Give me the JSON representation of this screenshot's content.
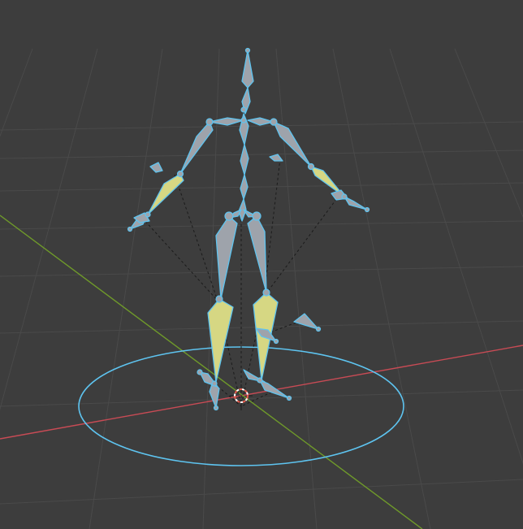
{
  "viewport": {
    "mode": "pose-mode",
    "selection": "armature-rig-all-bones-selected"
  },
  "colors": {
    "background": "#3d3d3d",
    "grid": "#4a4a4a",
    "x_axis": "#c84b55",
    "y_axis": "#6f9a2a",
    "selected_outline": "#5ec4f0",
    "bone_fill": "#9ea3ab",
    "ik_bone_fill": "#d6d783",
    "ik_line": "#1b1b1b",
    "cursor_red": "#e85a4a"
  },
  "icons": {
    "cursor": "3d-cursor-icon",
    "rig": "armature-rig"
  }
}
